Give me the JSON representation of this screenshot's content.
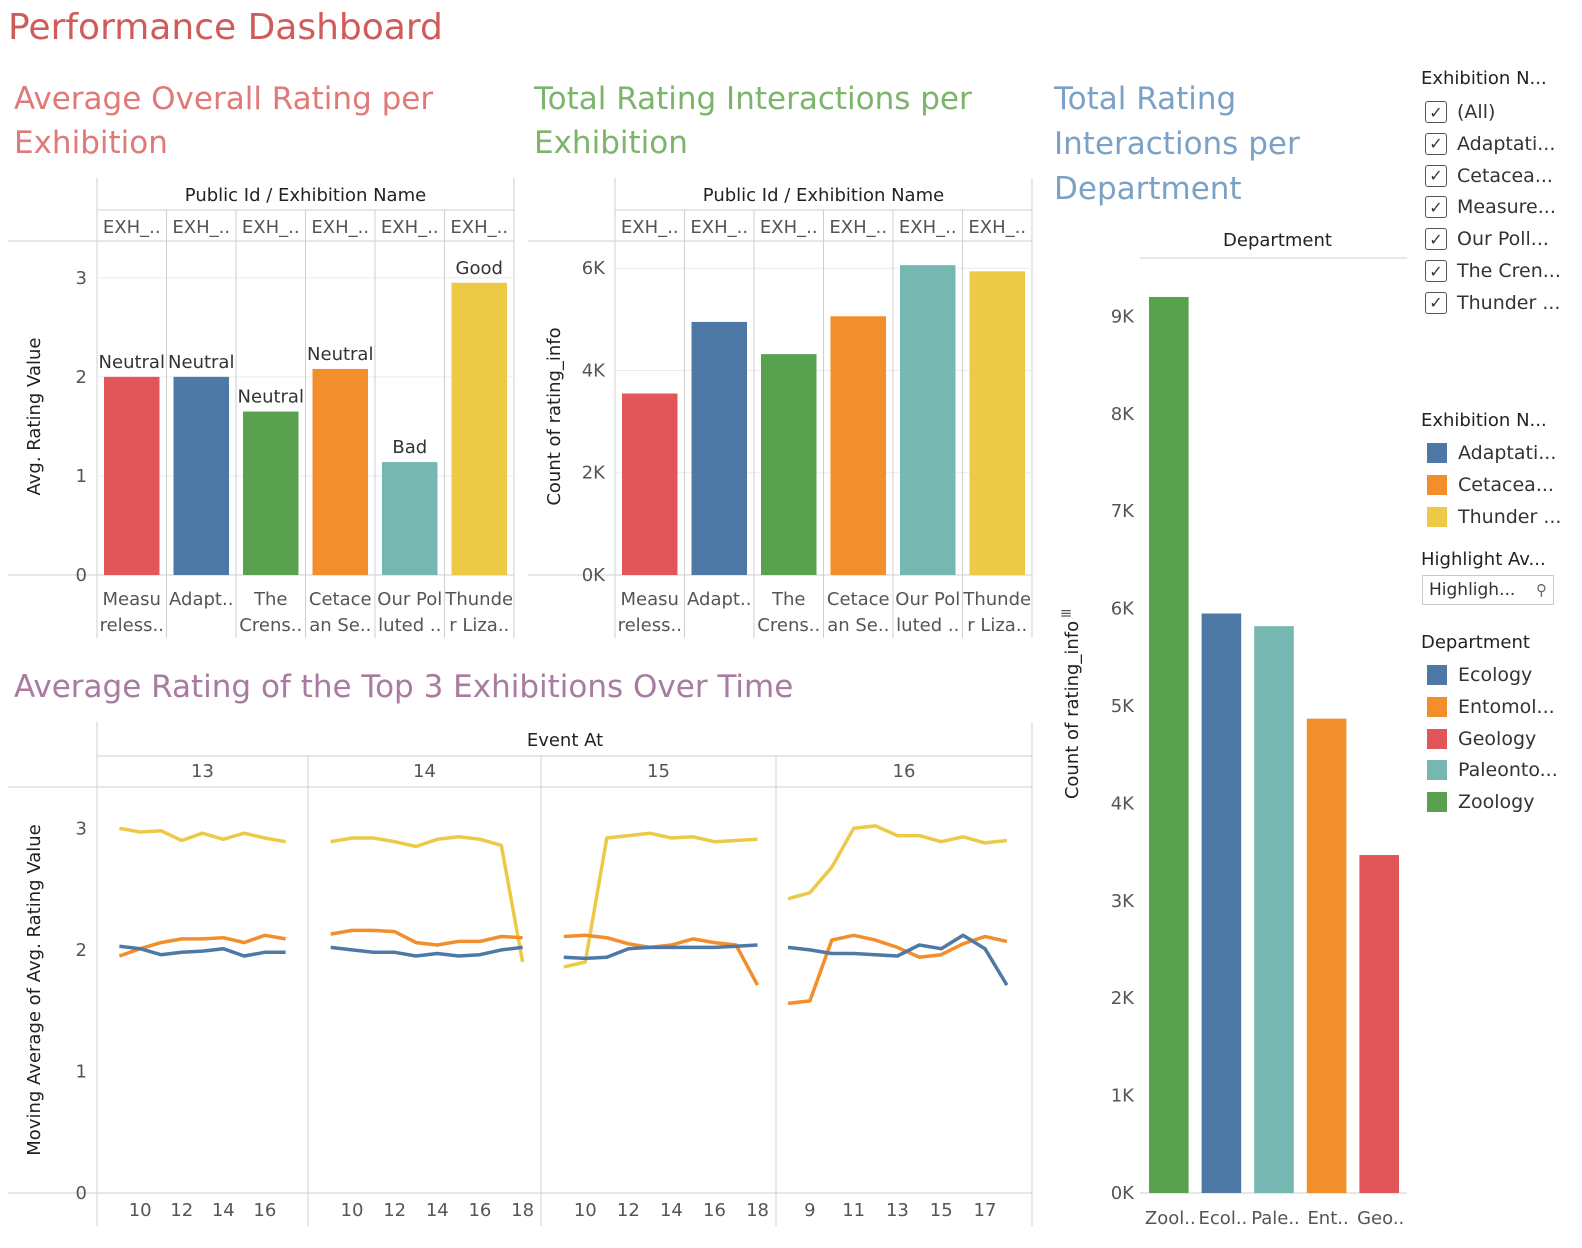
{
  "dashboard": {
    "title": "Performance Dashboard"
  },
  "chart1": {
    "title_line1": "Average Overall Rating per",
    "title_line2": "Exhibition"
  },
  "chart2": {
    "title_line1": "Total Rating Interactions per",
    "title_line2": "Exhibition"
  },
  "chart3": {
    "title_line1": "Total Rating",
    "title_line2": "Interactions per",
    "title_line3": "Department"
  },
  "chart4": {
    "title": "Average Rating of the Top 3 Exhibitions Over Time"
  },
  "legends": {
    "filter_title": "Exhibition N...",
    "filter_items": [
      "(All)",
      "Adaptati...",
      "Cetacea...",
      "Measure...",
      "Our Poll...",
      "The Cren...",
      "Thunder ..."
    ],
    "exhibition_title": "Exhibition N...",
    "exhibition_items": [
      {
        "label": "Adaptati...",
        "color": "#4e79a7"
      },
      {
        "label": "Cetacea...",
        "color": "#f28e2b"
      },
      {
        "label": "Thunder ...",
        "color": "#edc948"
      }
    ],
    "highlight_title": "Highlight Av...",
    "highlight_placeholder": "Highligh...",
    "department_title": "Department",
    "department_items": [
      {
        "label": "Ecology",
        "color": "#4e79a7"
      },
      {
        "label": "Entomol...",
        "color": "#f28e2b"
      },
      {
        "label": "Geology",
        "color": "#e15759"
      },
      {
        "label": "Paleonto...",
        "color": "#76b7b2"
      },
      {
        "label": "Zoology",
        "color": "#59a14f"
      }
    ]
  },
  "chart_data": [
    {
      "type": "bar",
      "header": "Public Id / Exhibition Name",
      "column_ids": [
        "EXH_..",
        "EXH_..",
        "EXH_..",
        "EXH_..",
        "EXH_..",
        "EXH_.."
      ],
      "categories_line1": [
        "Measu",
        "Adapt..",
        "The",
        "Cetace",
        "Our Pol",
        "Thunde"
      ],
      "categories_line2": [
        "reless..",
        "",
        "Crens..",
        "an Se..",
        "luted ..",
        "r Liza.."
      ],
      "values": [
        2.0,
        2.0,
        1.65,
        2.08,
        1.14,
        2.95
      ],
      "data_labels": [
        "Neutral",
        "Neutral",
        "Neutral",
        "Neutral",
        "Bad",
        "Good"
      ],
      "colors": [
        "#e15759",
        "#4e79a7",
        "#59a14f",
        "#f28e2b",
        "#76b7b2",
        "#edc948"
      ],
      "ylabel": "Avg. Rating Value",
      "ylim": [
        0,
        3.2
      ],
      "yticks": [
        0,
        1,
        2,
        3
      ],
      "ytick_labels": [
        "0",
        "1",
        "2",
        "3"
      ]
    },
    {
      "type": "bar",
      "header": "Public Id / Exhibition Name",
      "column_ids": [
        "EXH_..",
        "EXH_..",
        "EXH_..",
        "EXH_..",
        "EXH_..",
        "EXH_.."
      ],
      "categories_line1": [
        "Measu",
        "Adapt..",
        "The",
        "Cetace",
        "Our Pol",
        "Thunde"
      ],
      "categories_line2": [
        "reless..",
        "",
        "Crens..",
        "an Se..",
        "luted ..",
        "r Liza.."
      ],
      "values": [
        3550,
        4950,
        4320,
        5060,
        6060,
        5940
      ],
      "colors": [
        "#e15759",
        "#4e79a7",
        "#59a14f",
        "#f28e2b",
        "#76b7b2",
        "#edc948"
      ],
      "ylabel": "Count of rating_info",
      "ylim": [
        0,
        6200
      ],
      "yticks": [
        0,
        2000,
        4000,
        6000
      ],
      "ytick_labels": [
        "0K",
        "2K",
        "4K",
        "6K"
      ]
    },
    {
      "type": "bar",
      "header": "Department",
      "categories": [
        "Zool..",
        "Ecol..",
        "Pale..",
        "Ent..",
        "Geo.."
      ],
      "values": [
        9200,
        5950,
        5820,
        4870,
        3470
      ],
      "colors": [
        "#59a14f",
        "#4e79a7",
        "#76b7b2",
        "#f28e2b",
        "#e15759"
      ],
      "ylabel": "Count of rating_info",
      "ylim": [
        0,
        9600
      ],
      "yticks": [
        0,
        1000,
        2000,
        3000,
        4000,
        5000,
        6000,
        7000,
        8000,
        9000
      ],
      "ytick_labels": [
        "0K",
        "1K",
        "2K",
        "3K",
        "4K",
        "5K",
        "6K",
        "7K",
        "8K",
        "9K"
      ]
    },
    {
      "type": "line",
      "header": "Event At",
      "ylabel": "Moving Average of Avg. Rating Value",
      "ylim": [
        0,
        3.2
      ],
      "yticks": [
        0,
        1,
        2,
        3
      ],
      "ytick_labels": [
        "0",
        "1",
        "2",
        "3"
      ],
      "panels": [
        {
          "label": "13",
          "x": [
            9,
            10,
            11,
            12,
            13,
            14,
            15,
            16,
            17,
            18
          ],
          "xticks": [
            10,
            12,
            14,
            16
          ],
          "series": [
            {
              "color": "#edc948",
              "values": [
                3.0,
                2.97,
                2.98,
                2.9,
                2.96,
                2.91,
                2.96,
                2.92,
                2.89,
                null
              ]
            },
            {
              "color": "#f28e2b",
              "values": [
                1.95,
                2.01,
                2.06,
                2.09,
                2.09,
                2.1,
                2.06,
                2.12,
                2.09,
                null
              ]
            },
            {
              "color": "#4e79a7",
              "values": [
                2.03,
                2.01,
                1.96,
                1.98,
                1.99,
                2.01,
                1.95,
                1.98,
                1.98,
                null
              ]
            }
          ]
        },
        {
          "label": "14",
          "x": [
            9,
            10,
            11,
            12,
            13,
            14,
            15,
            16,
            17,
            18
          ],
          "xticks": [
            10,
            12,
            14,
            16,
            18
          ],
          "series": [
            {
              "color": "#edc948",
              "values": [
                2.89,
                2.92,
                2.92,
                2.89,
                2.85,
                2.91,
                2.93,
                2.91,
                2.86,
                1.9
              ]
            },
            {
              "color": "#f28e2b",
              "values": [
                2.13,
                2.16,
                2.16,
                2.15,
                2.06,
                2.04,
                2.07,
                2.07,
                2.11,
                2.1
              ]
            },
            {
              "color": "#4e79a7",
              "values": [
                2.02,
                2.0,
                1.98,
                1.98,
                1.95,
                1.97,
                1.95,
                1.96,
                2.0,
                2.02
              ]
            }
          ]
        },
        {
          "label": "15",
          "x": [
            9,
            10,
            11,
            12,
            13,
            14,
            15,
            16,
            17,
            18
          ],
          "xticks": [
            10,
            12,
            14,
            16,
            18
          ],
          "series": [
            {
              "color": "#edc948",
              "values": [
                1.86,
                1.9,
                2.92,
                2.94,
                2.96,
                2.92,
                2.93,
                2.89,
                2.9,
                2.91
              ]
            },
            {
              "color": "#f28e2b",
              "values": [
                2.11,
                2.12,
                2.1,
                2.05,
                2.02,
                2.04,
                2.09,
                2.06,
                2.04,
                1.71
              ]
            },
            {
              "color": "#4e79a7",
              "values": [
                1.94,
                1.93,
                1.94,
                2.01,
                2.02,
                2.02,
                2.02,
                2.02,
                2.03,
                2.04
              ]
            }
          ]
        },
        {
          "label": "16",
          "x": [
            8,
            9,
            10,
            11,
            12,
            13,
            14,
            15,
            16,
            17,
            18
          ],
          "xticks": [
            9,
            11,
            13,
            15,
            17
          ],
          "series": [
            {
              "color": "#edc948",
              "values": [
                2.42,
                2.47,
                2.68,
                3.0,
                3.02,
                2.94,
                2.94,
                2.89,
                2.93,
                2.88,
                2.9
              ]
            },
            {
              "color": "#f28e2b",
              "values": [
                1.56,
                1.58,
                2.08,
                2.12,
                2.08,
                2.02,
                1.94,
                1.96,
                2.05,
                2.11,
                2.07
              ]
            },
            {
              "color": "#4e79a7",
              "values": [
                2.02,
                2.0,
                1.97,
                1.97,
                1.96,
                1.95,
                2.04,
                2.01,
                2.12,
                2.01,
                1.71
              ]
            }
          ]
        }
      ]
    }
  ]
}
